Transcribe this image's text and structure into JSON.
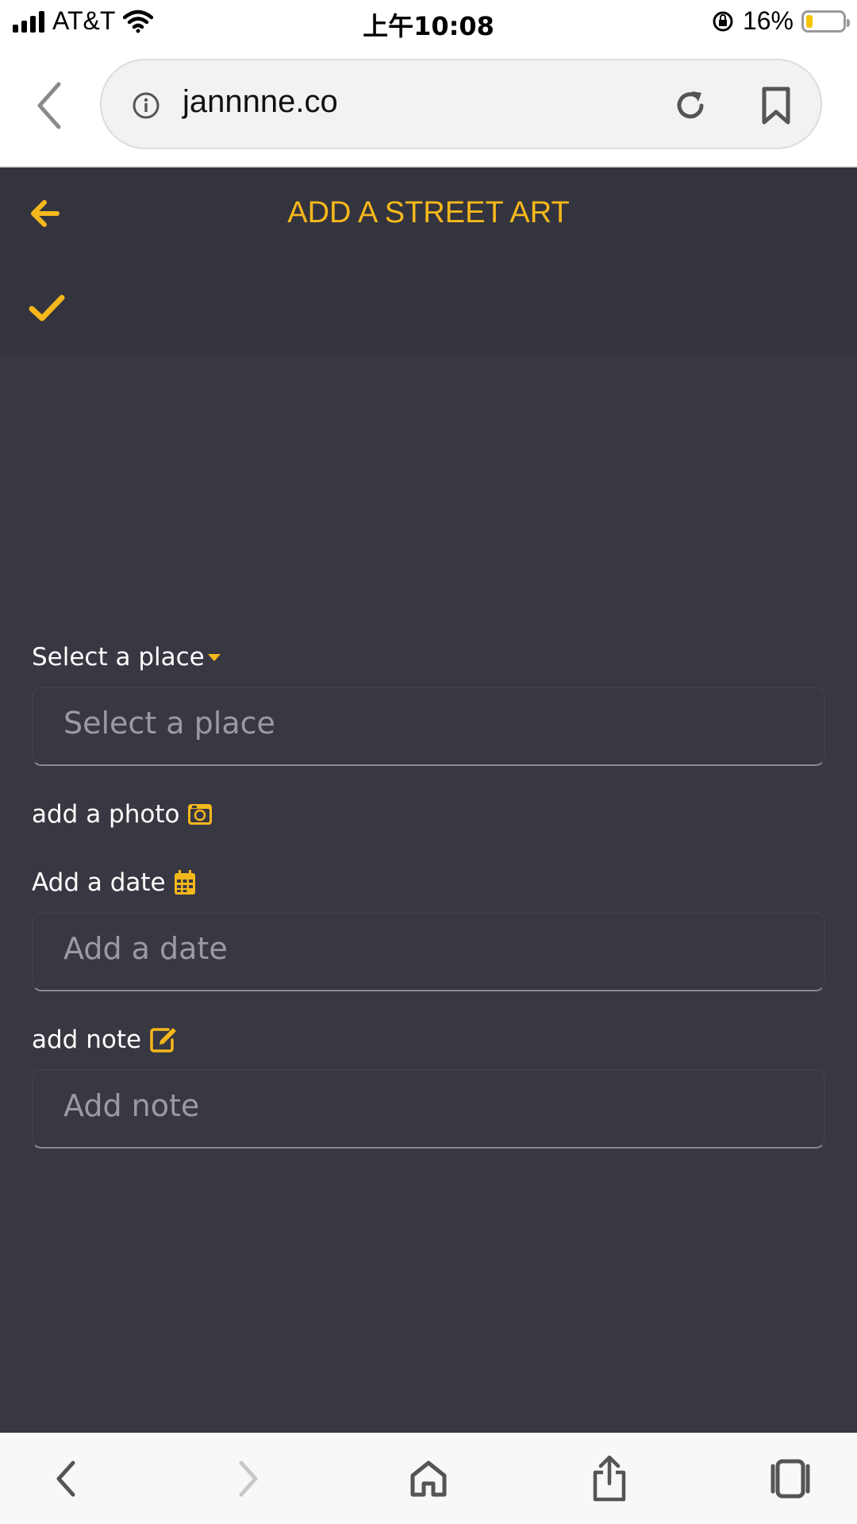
{
  "status_bar": {
    "carrier": "AT&T",
    "time": "上午10:08",
    "battery": "16%",
    "battery_level": 0.16
  },
  "browser": {
    "url": "jannnne.co"
  },
  "header": {
    "title": "ADD A STREET ART"
  },
  "form": {
    "place_label": "Select a place",
    "place_placeholder": "Select a place",
    "photo_label": "add a photo",
    "date_label": "Add a date",
    "date_placeholder": "Add a date",
    "note_label": "add note",
    "note_placeholder": "Add note"
  },
  "colors": {
    "accent": "#f5b81c",
    "background": "#383842",
    "header": "#34343e"
  },
  "icons": [
    "back-arrow-icon",
    "check-icon",
    "dropdown-caret-icon",
    "camera-icon",
    "calendar-icon",
    "edit-icon"
  ]
}
